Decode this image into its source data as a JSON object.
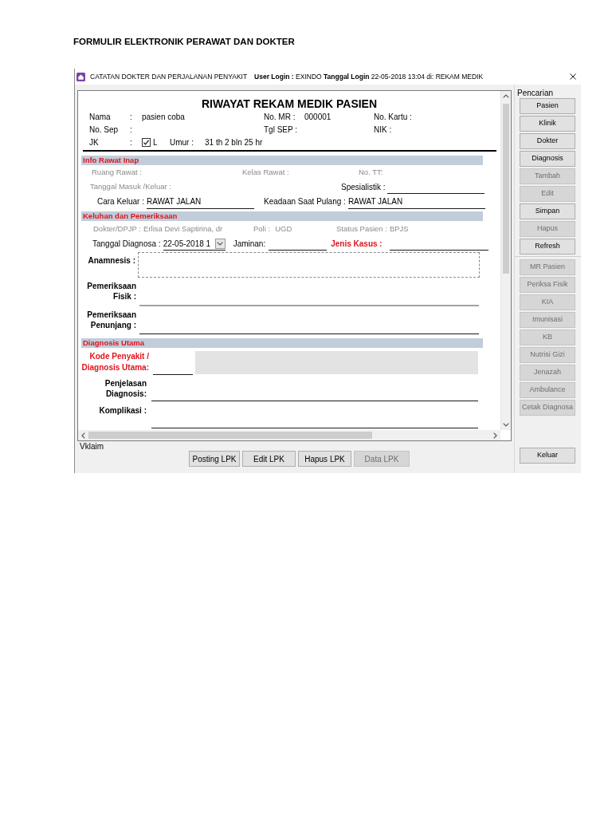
{
  "page_heading": "FORMULIR ELEKTRONIK PERAWAT DAN DOKTER",
  "window": {
    "title": "CATATAN DOKTER DAN PERJALANAN PENYAKIT",
    "login_info": "**User Login :** EXINDO **Tanggal Login** 22-05-2018 13:04 di: REKAM MEDIK"
  },
  "form": {
    "title": "RIWAYAT REKAM MEDIK PASIEN",
    "patient_rows": [
      {
        "label": "Nama",
        "separator": ":",
        "value": "pasien coba",
        "mid_label": "No. MR :",
        "mid_value": "000001",
        "right_label": "No. Kartu :"
      },
      {
        "label": "No. Sep",
        "separator": ":",
        "mid_label": "Tgl SEP :",
        "right_label": "NIK :"
      }
    ],
    "jk": {
      "label": "JK",
      "separator": ":",
      "checked": true,
      "option": "L",
      "age_label": "Umur :",
      "age_value": "31 th 2 bln 25 hr"
    },
    "info_rawat_inap": {
      "heading": "Info Rawat Inap",
      "ruang_rawat": {
        "label": "Ruang Rawat :",
        "disabled": true
      },
      "kelas_rawat": {
        "label": "Kelas Rawat :",
        "disabled": true
      },
      "no_tt": {
        "label": "No. TT:",
        "disabled": true
      },
      "tanggal_masuk_keluar": {
        "label": "Tanggal Masuk /Keluar :",
        "disabled": true
      },
      "spesialistik": {
        "label": "Spesialistik :"
      },
      "cara_keluar": {
        "label": "Cara Keluar :",
        "value": "RAWAT JALAN"
      },
      "keadaan_saat_pulang": {
        "label": "Keadaan Saat Pulang :",
        "value": "RAWAT JALAN"
      }
    },
    "keluhan": {
      "heading": "Keluhan dan Pemeriksaan",
      "dokter": {
        "label": "Dokter/DPJP :",
        "value": "Erlisa Devi Saptirina, dr",
        "disabled": true
      },
      "poli": {
        "label": "Poli :",
        "value": "UGD",
        "disabled": true
      },
      "status_pasien": {
        "label": "Status Pasien :",
        "value": "BPJS",
        "disabled": true
      },
      "tanggal_diagnosa": {
        "label": "Tanggal Diagnosa :",
        "value": "22-05-2018 1"
      },
      "jaminan": {
        "label": "Jaminan:"
      },
      "jenis_kasus": {
        "label": "Jenis Kasus :",
        "required": true
      },
      "anamnesis": {
        "label": "Anamnesis :"
      },
      "pemeriksaan_fisik": {
        "label": "Pemeriksaan Fisik :"
      },
      "pemeriksaan_penunjang": {
        "label": "Pemeriksaan Penunjang :"
      }
    },
    "diagnosis_utama": {
      "heading": "Diagnosis Utama",
      "kode_penyakit": {
        "label": "Kode Penyakit / Diagnosis Utama:",
        "required": true
      },
      "penjelasan": {
        "label": "Penjelasan Diagnosis:"
      },
      "komplikasi": {
        "label": "Komplikasi :"
      }
    }
  },
  "footer": {
    "status_label": "Vklaim",
    "buttons": [
      {
        "label": "Posting LPK",
        "disabled": false
      },
      {
        "label": "Edit LPK",
        "disabled": false
      },
      {
        "label": "Hapus LPK",
        "disabled": false
      },
      {
        "label": "Data LPK",
        "disabled": true
      }
    ]
  },
  "side_panel": {
    "title": "Pencarian",
    "buttons": [
      {
        "label": "Pasien",
        "disabled": false
      },
      {
        "label": "Klinik",
        "disabled": false
      },
      {
        "label": "Dokter",
        "disabled": false
      },
      {
        "label": "Diagnosis",
        "disabled": false
      },
      {
        "label": "Tambah",
        "disabled": true
      },
      {
        "label": "Edit",
        "disabled": true
      },
      {
        "label": "Simpan",
        "disabled": false
      },
      {
        "label": "Hapus",
        "disabled": true
      },
      {
        "label": "Refresh",
        "disabled": false
      }
    ],
    "extra_buttons": [
      {
        "label": "MR Pasien",
        "disabled": true
      },
      {
        "label": "Periksa Fisik",
        "disabled": true
      },
      {
        "label": "KIA",
        "disabled": true
      },
      {
        "label": "Imunisasi",
        "disabled": true
      },
      {
        "label": "KB",
        "disabled": true
      },
      {
        "label": "Nutrisi Gizi",
        "disabled": true
      },
      {
        "label": "Jenazah",
        "disabled": true
      },
      {
        "label": "Ambulance",
        "disabled": true
      },
      {
        "label": "Cetak Diagnosa",
        "disabled": true
      }
    ],
    "exit_button": {
      "label": "Keluar",
      "disabled": false
    }
  }
}
